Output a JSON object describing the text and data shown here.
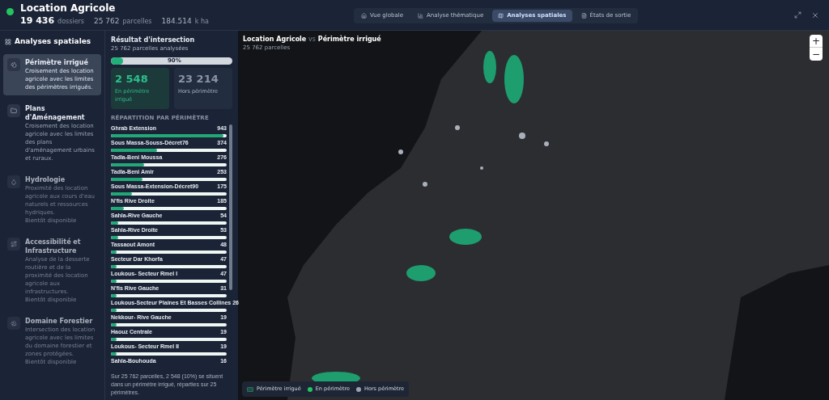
{
  "header": {
    "title": "Location Agricole",
    "stats": [
      {
        "value": "19 436",
        "unit": "dossiers"
      },
      {
        "value": "25 762",
        "unit": "parcelles"
      },
      {
        "value": "184.514",
        "unit": "k ha"
      }
    ]
  },
  "tabs": [
    {
      "label": "Vue globale",
      "selected": false
    },
    {
      "label": "Analyse thématique",
      "selected": false
    },
    {
      "label": "Analyses spatiales",
      "selected": true
    },
    {
      "label": "États de sortie",
      "selected": false
    }
  ],
  "sidebar": {
    "title": "Analyses spatiales",
    "items": [
      {
        "title": "Périmètre irrigué",
        "description": "Croisement des location agricole avec les limites des périmètres irrigués.",
        "selected": true,
        "disabled": false
      },
      {
        "title": "Plans d'Aménagement",
        "description": "Croisement des location agricole avec les limites des plans d'aménagement urbains et ruraux.",
        "selected": false,
        "disabled": false
      },
      {
        "title": "Hydrologie",
        "description": "Proximité des location agricole aux cours d'eau naturels et ressources hydriques.",
        "note": "Bientôt disponible",
        "selected": false,
        "disabled": true
      },
      {
        "title": "Accessibilité et Infrastructure",
        "description": "Analyse de la desserte routière et de la proximité des location agricole aux infrastructures.",
        "note": "Bientôt disponible",
        "selected": false,
        "disabled": true
      },
      {
        "title": "Domaine Forestier",
        "description": "Intersection des location agricole avec les limites du domaine forestier et zones protégées.",
        "note": "Bientôt disponible",
        "selected": false,
        "disabled": true
      }
    ]
  },
  "result": {
    "title": "Résultat d'intersection",
    "subtitle": "25 762 parcelles analysées",
    "progress": {
      "level": 0.1,
      "label": "90%"
    },
    "cards": [
      {
        "value": "2 548",
        "label": "En périmètre irrigué",
        "kind": "inside"
      },
      {
        "value": "23 214",
        "label": "Hors périmètre",
        "kind": "outside"
      }
    ],
    "breakdown_title": "RÉPARTITION PAR PÉRIMÈTRE",
    "perimeters": [
      {
        "name": "Ghrab Extension",
        "count": "943",
        "level": 0.97
      },
      {
        "name": "Sous Massa-Souss-Décret76",
        "count": "374",
        "level": 0.4
      },
      {
        "name": "Tadla-Beni Moussa",
        "count": "276",
        "level": 0.29
      },
      {
        "name": "Tadla-Beni Amir",
        "count": "253",
        "level": 0.27
      },
      {
        "name": "Sous Massa-Extension-Décret90",
        "count": "175",
        "level": 0.18
      },
      {
        "name": "N'fis Rive Droite",
        "count": "185",
        "level": 0.11
      },
      {
        "name": "Sahla-Rive Gauche",
        "count": "54",
        "level": 0.06
      },
      {
        "name": "Sahla-Rive Droite",
        "count": "53",
        "level": 0.06
      },
      {
        "name": "Tassaout Amont",
        "count": "48",
        "level": 0.05
      },
      {
        "name": "Secteur Dar Khorfa",
        "count": "47",
        "level": 0.05
      },
      {
        "name": "Loukous- Secteur Rmel I",
        "count": "47",
        "level": 0.05
      },
      {
        "name": "N'fis Rive Gauche",
        "count": "31",
        "level": 0.05
      },
      {
        "name": "Loukous-Secteur Plaines Et Basses Collines",
        "count": "26",
        "level": 0.05
      },
      {
        "name": "Nekkour- Rive Gauche",
        "count": "19",
        "level": 0.05
      },
      {
        "name": "Haouz Centrale",
        "count": "19",
        "level": 0.05
      },
      {
        "name": "Loukous- Secteur Rmel II",
        "count": "19",
        "level": 0.05
      },
      {
        "name": "Sahla-Bouhouda",
        "count": "16"
      }
    ],
    "summary": "Sur 25 762 parcelles, 2 548 (10%) se situent dans un périmètre irrigué, réparties sur 25 périmètres."
  },
  "map": {
    "title": "Location Agricole",
    "title_joiner": "vs",
    "title_2": "Périmètre irrigué",
    "subtitle": "25 762 parcelles",
    "zoom_in": "+",
    "zoom_out": "−",
    "legend": [
      {
        "label": "Périmètre irrigué",
        "kind": "area",
        "color": "#1f4d3f"
      },
      {
        "label": "En périmètre",
        "kind": "dot",
        "color": "#22c55e"
      },
      {
        "label": "Hors périmètre",
        "kind": "dot",
        "color": "#9ca3af"
      }
    ]
  }
}
